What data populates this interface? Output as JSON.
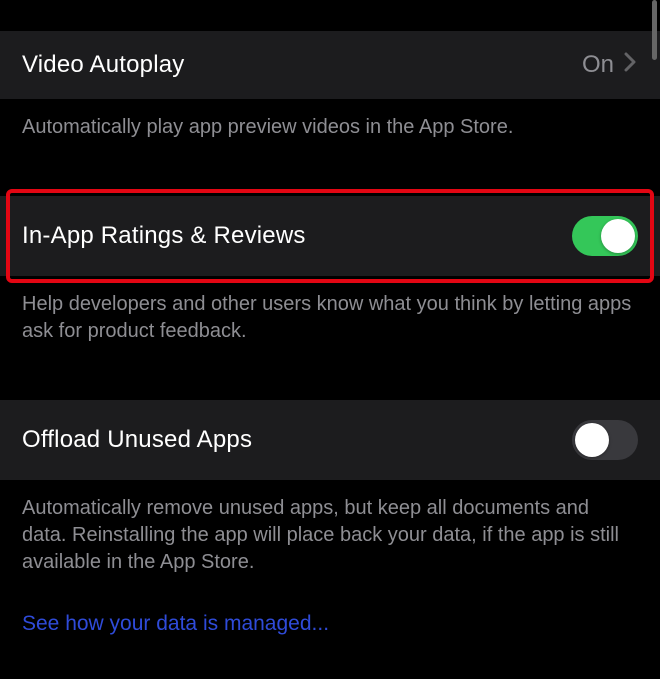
{
  "sections": {
    "video_autoplay": {
      "title": "Video Autoplay",
      "value": "On",
      "footer": "Automatically play app preview videos in the App Store."
    },
    "in_app_ratings": {
      "title": "In-App Ratings & Reviews",
      "toggle_on": true,
      "footer": "Help developers and other users know what you think by letting apps ask for product feedback."
    },
    "offload": {
      "title": "Offload Unused Apps",
      "toggle_on": false,
      "footer": "Automatically remove unused apps, but keep all documents and data. Reinstalling the app will place back your data, if the app is still available in the App Store."
    }
  },
  "link": "See how your data is managed..."
}
